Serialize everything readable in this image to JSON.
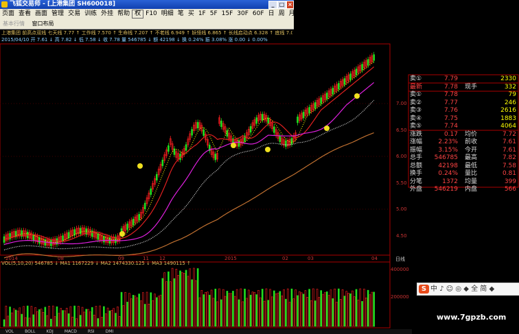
{
  "window": {
    "title": "飞狐交易师 - [上港集团 SH600018]"
  },
  "menu": [
    "页面",
    "查看",
    "画面",
    "管理",
    "交易",
    "训练",
    "外挂",
    "帮助",
    "权",
    "F10",
    "明细",
    "笔",
    "买",
    "1F",
    "5F",
    "15F",
    "30F",
    "60F",
    "日",
    "周",
    "月"
  ],
  "toolbar": {
    "items": [
      "基本行情",
      "窗口布局"
    ]
  },
  "indicators": {
    "line1": "上港集团 前高点双线 七天线 7.77 ↑ 工作线 7.570 ↑ 生命线 7.207 ↑ 不老线 6.949 ↑ 妖怪线 6.865 ↑ 长线启动点 6.328 ↑ 底线 7.001 ↑",
    "line2": "2015/04/10 开 7.61 ↓ 高 7.82 ↓ 低 7.58 ↓ 收 7.78 量 546785 ↓ 额 42198 ↓ 换 0.24% 振 3.08% 涨 0.00 ↓ 0.00%"
  },
  "price_axis": [
    "7.00",
    "6.50",
    "6.00",
    "5.50",
    "5.00",
    "4.50"
  ],
  "volume_axis": [
    "400000",
    "200000"
  ],
  "x_labels": [
    "2014",
    "08",
    "09",
    "11",
    "12",
    "2015",
    "02",
    "03",
    "04"
  ],
  "axis_note": "日线",
  "volume_line": "VOL(5,10,20) 546785 ↓ MA1 1167229 ↓ MA2 1474330.125 ↓ MA3 1490115 ↑",
  "quote": {
    "asks": [
      {
        "label": "卖⑤",
        "price": "7.74",
        "vol": "4064"
      },
      {
        "label": "卖④",
        "price": "7.75",
        "vol": "1883"
      },
      {
        "label": "卖③",
        "price": "7.76",
        "vol": "2616"
      },
      {
        "label": "卖②",
        "price": "7.77",
        "vol": "246"
      },
      {
        "label": "卖①",
        "price": "7.78",
        "vol": "79"
      }
    ],
    "latest": {
      "label": "最新",
      "price": "7.78",
      "label2": "现手",
      "vol": "332"
    },
    "top": {
      "label": "卖①",
      "price": "7.79",
      "vol": "2330"
    },
    "stats": [
      {
        "l": "涨跌",
        "v1": "0.17",
        "l2": "均价",
        "v2": "7.72"
      },
      {
        "l": "涨幅",
        "v1": "2.23%",
        "l2": "前收",
        "v2": "7.61"
      },
      {
        "l": "振幅",
        "v1": "3.15%",
        "l2": "今开",
        "v2": "7.61"
      },
      {
        "l": "总手",
        "v1": "546785",
        "l2": "最高",
        "v2": "7.82"
      },
      {
        "l": "总额",
        "v1": "42198",
        "l2": "最低",
        "v2": "7.58"
      },
      {
        "l": "换手",
        "v1": "0.24%",
        "l2": "量比",
        "v2": "0.81"
      },
      {
        "l": "分笔",
        "v1": "1372",
        "l2": "均量",
        "v2": "399"
      },
      {
        "l": "外盘",
        "v1": "546219",
        "l2": "内盘",
        "v2": "566"
      }
    ]
  },
  "sogou": {
    "text": "中 ♪ ☺ ◎ ◆ 全 简 ◆"
  },
  "watermark": "www.7gpzb.com",
  "bottom_tabs": [
    "VOL",
    "BOLL",
    "KDJ",
    "MACD",
    "RSI",
    "DMI"
  ],
  "colors": {
    "up": "#ff2020",
    "down": "#20e020",
    "ma_red": "#e02020",
    "ma_magenta": "#e020e0",
    "ma_white": "#e0e0e0",
    "ma_orange": "#c07030",
    "ma_yellow": "#f0f000"
  }
}
